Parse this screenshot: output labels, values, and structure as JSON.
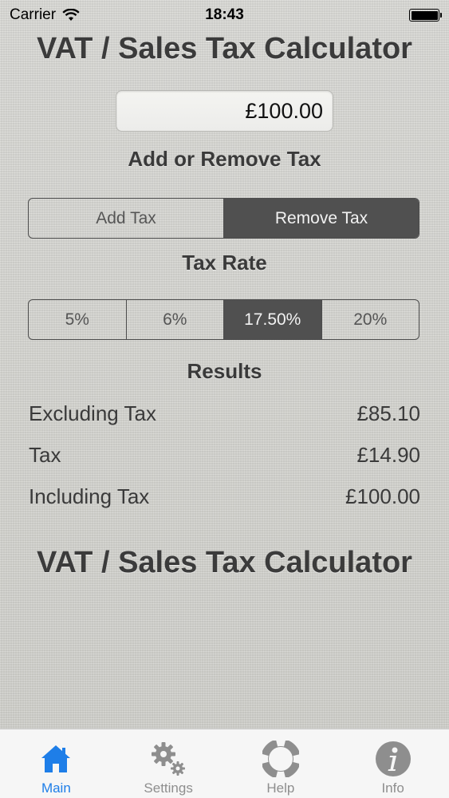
{
  "status_bar": {
    "carrier": "Carrier",
    "time": "18:43",
    "wifi_icon": "wifi-icon",
    "battery_icon": "battery-icon"
  },
  "header": {
    "title": "VAT / Sales Tax Calculator"
  },
  "amount": {
    "value": "£100.00"
  },
  "mode": {
    "label": "Add or Remove Tax",
    "options": [
      "Add Tax",
      "Remove Tax"
    ],
    "selected": "Remove Tax"
  },
  "tax_rate": {
    "label": "Tax Rate",
    "options": [
      "5%",
      "6%",
      "17.50%",
      "20%"
    ],
    "selected": "17.50%"
  },
  "results": {
    "label": "Results",
    "rows": [
      {
        "label": "Excluding Tax",
        "value": "£85.10"
      },
      {
        "label": "Tax",
        "value": "£14.90"
      },
      {
        "label": "Including Tax",
        "value": "£100.00"
      }
    ]
  },
  "footer_title": "VAT / Sales Tax Calculator",
  "tabs": [
    {
      "label": "Main",
      "icon": "home-icon",
      "active": true
    },
    {
      "label": "Settings",
      "icon": "gears-icon",
      "active": false
    },
    {
      "label": "Help",
      "icon": "lifebuoy-icon",
      "active": false
    },
    {
      "label": "Info",
      "icon": "info-icon",
      "active": false
    }
  ],
  "colors": {
    "accent": "#1e7ee8",
    "selected_segment": "#505050",
    "inactive_tab": "#8e8e8e"
  }
}
